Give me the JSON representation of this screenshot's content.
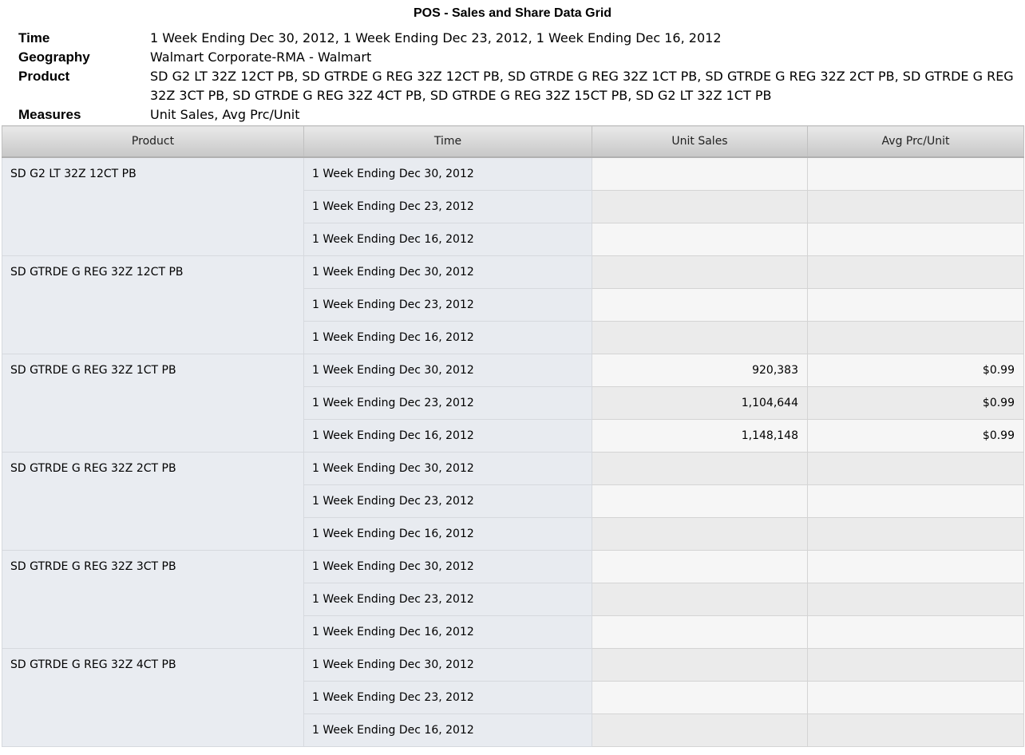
{
  "report": {
    "title": "POS - Sales and Share Data Grid"
  },
  "meta": [
    {
      "label": "Time",
      "value": "1 Week Ending Dec 30, 2012, 1 Week Ending Dec 23, 2012, 1 Week Ending Dec 16, 2012"
    },
    {
      "label": "Geography",
      "value": "Walmart Corporate-RMA - Walmart"
    },
    {
      "label": "Product",
      "value": "SD G2 LT 32Z 12CT PB, SD GTRDE G REG 32Z 12CT PB, SD GTRDE G REG 32Z 1CT PB, SD GTRDE G REG 32Z 2CT PB, SD GTRDE G REG 32Z 3CT PB, SD GTRDE G REG 32Z 4CT PB, SD GTRDE G REG 32Z 15CT PB, SD G2 LT 32Z 1CT PB"
    },
    {
      "label": "Measures",
      "value": "Unit Sales, Avg Prc/Unit"
    }
  ],
  "grid": {
    "columns": [
      "Product",
      "Time",
      "Unit Sales",
      "Avg Prc/Unit"
    ],
    "products": [
      {
        "name": "SD G2 LT 32Z 12CT PB",
        "rows": [
          {
            "time": "1 Week Ending Dec 30, 2012",
            "unit_sales": "",
            "avg_price": ""
          },
          {
            "time": "1 Week Ending Dec 23, 2012",
            "unit_sales": "",
            "avg_price": ""
          },
          {
            "time": "1 Week Ending Dec 16, 2012",
            "unit_sales": "",
            "avg_price": ""
          }
        ]
      },
      {
        "name": "SD GTRDE G REG 32Z 12CT PB",
        "rows": [
          {
            "time": "1 Week Ending Dec 30, 2012",
            "unit_sales": "",
            "avg_price": ""
          },
          {
            "time": "1 Week Ending Dec 23, 2012",
            "unit_sales": "",
            "avg_price": ""
          },
          {
            "time": "1 Week Ending Dec 16, 2012",
            "unit_sales": "",
            "avg_price": ""
          }
        ]
      },
      {
        "name": "SD GTRDE G REG 32Z 1CT PB",
        "rows": [
          {
            "time": "1 Week Ending Dec 30, 2012",
            "unit_sales": "920,383",
            "avg_price": "$0.99"
          },
          {
            "time": "1 Week Ending Dec 23, 2012",
            "unit_sales": "1,104,644",
            "avg_price": "$0.99"
          },
          {
            "time": "1 Week Ending Dec 16, 2012",
            "unit_sales": "1,148,148",
            "avg_price": "$0.99"
          }
        ]
      },
      {
        "name": "SD GTRDE G REG 32Z 2CT PB",
        "rows": [
          {
            "time": "1 Week Ending Dec 30, 2012",
            "unit_sales": "",
            "avg_price": ""
          },
          {
            "time": "1 Week Ending Dec 23, 2012",
            "unit_sales": "",
            "avg_price": ""
          },
          {
            "time": "1 Week Ending Dec 16, 2012",
            "unit_sales": "",
            "avg_price": ""
          }
        ]
      },
      {
        "name": "SD GTRDE G REG 32Z 3CT PB",
        "rows": [
          {
            "time": "1 Week Ending Dec 30, 2012",
            "unit_sales": "",
            "avg_price": ""
          },
          {
            "time": "1 Week Ending Dec 23, 2012",
            "unit_sales": "",
            "avg_price": ""
          },
          {
            "time": "1 Week Ending Dec 16, 2012",
            "unit_sales": "",
            "avg_price": ""
          }
        ]
      },
      {
        "name": "SD GTRDE G REG 32Z 4CT PB",
        "rows": [
          {
            "time": "1 Week Ending Dec 30, 2012",
            "unit_sales": "",
            "avg_price": ""
          },
          {
            "time": "1 Week Ending Dec 23, 2012",
            "unit_sales": "",
            "avg_price": ""
          },
          {
            "time": "1 Week Ending Dec 16, 2012",
            "unit_sales": "",
            "avg_price": ""
          }
        ]
      }
    ]
  }
}
